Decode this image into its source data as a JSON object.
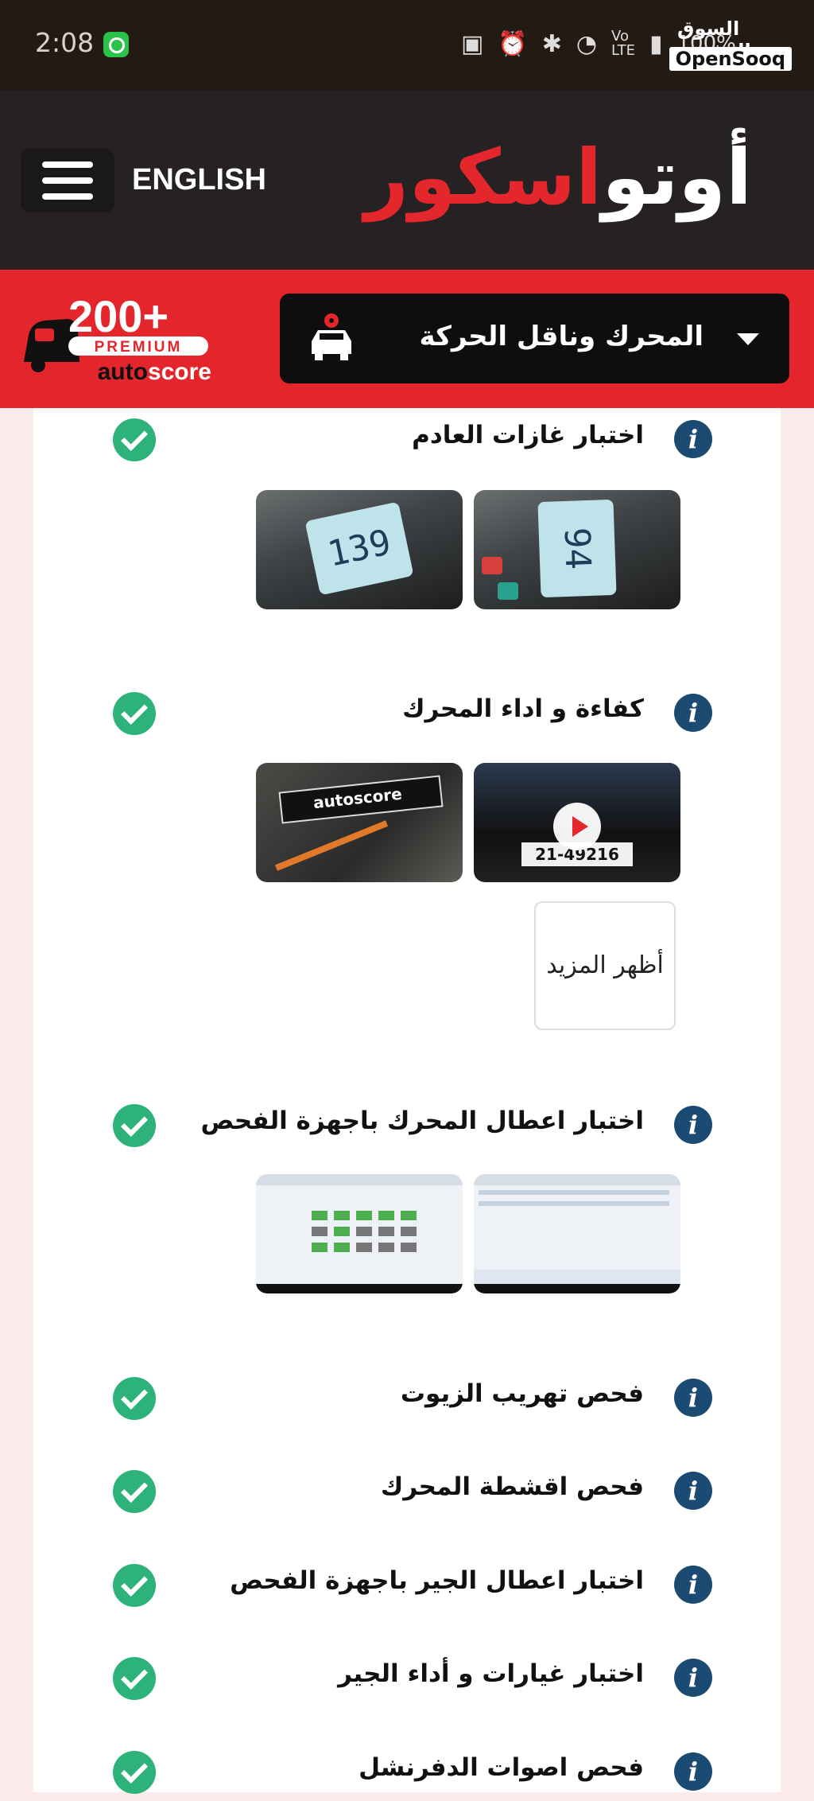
{
  "status_bar": {
    "time": "2:08",
    "battery_text": "100%",
    "icons": [
      "whatsapp-icon",
      "nfc-icon",
      "alarm-icon",
      "bluetooth-icon",
      "wifi-icon",
      "volte-icon",
      "signal-icon",
      "battery-icon"
    ],
    "watermark": {
      "arabic": "السوق المفتوح",
      "latin": "OpenSooq"
    }
  },
  "header": {
    "language_label": "ENGLISH",
    "logo": {
      "part1": "أوتو",
      "part2": "اسكور"
    }
  },
  "category_bar": {
    "selected": "المحرك وناقل الحركة",
    "badge": {
      "count": "200+",
      "tier": "PREMIUM",
      "brand": "autoscore"
    }
  },
  "inspection": {
    "items": [
      {
        "title": "اختبار غازات العادم",
        "status": "passed"
      },
      {
        "title": "كفاءة و اداء المحرك",
        "status": "passed"
      },
      {
        "title": "اختبار اعطال المحرك باجهزة الفحص",
        "status": "passed"
      },
      {
        "title": "فحص تهريب الزيوت",
        "status": "passed"
      },
      {
        "title": "فحص اقشطة المحرك",
        "status": "passed"
      },
      {
        "title": "اختبار اعطال الجير باجهزة الفحص",
        "status": "passed"
      },
      {
        "title": "اختبار غيارات و أداء الجير",
        "status": "passed"
      },
      {
        "title": "فحص اصوات الدفرنشل",
        "status": "passed"
      }
    ],
    "photo_readings": {
      "gauge_1": "94",
      "gauge_2": "139"
    },
    "engine_photo_text": "autoscore",
    "plate_text": "21-49216",
    "show_more_label": "أظهر المزيد"
  },
  "colors": {
    "brand_red": "#e4262c",
    "header_dark": "#262223",
    "check_green": "#2db37a",
    "info_blue": "#1b4a73"
  }
}
